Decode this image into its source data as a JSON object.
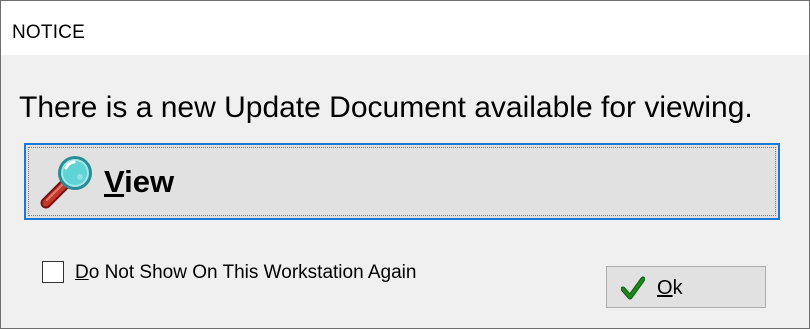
{
  "window": {
    "title": "NOTICE"
  },
  "message": "There is a new Update Document available for viewing.",
  "view_button": {
    "label_underlined": "V",
    "label_rest": "iew",
    "icon": "magnifier-icon"
  },
  "do_not_show": {
    "label_underlined": "D",
    "label_rest": "o Not Show On This Workstation Again",
    "checked": false
  },
  "ok_button": {
    "label_underlined": "O",
    "label_rest": "k",
    "icon": "checkmark-icon"
  },
  "colors": {
    "focus_border": "#1a78d6",
    "button_face": "#e1e1e1",
    "checkmark": "#1b8a1b",
    "magnifier_handle": "#c0392b",
    "magnifier_lens": "#5fd3d6"
  }
}
